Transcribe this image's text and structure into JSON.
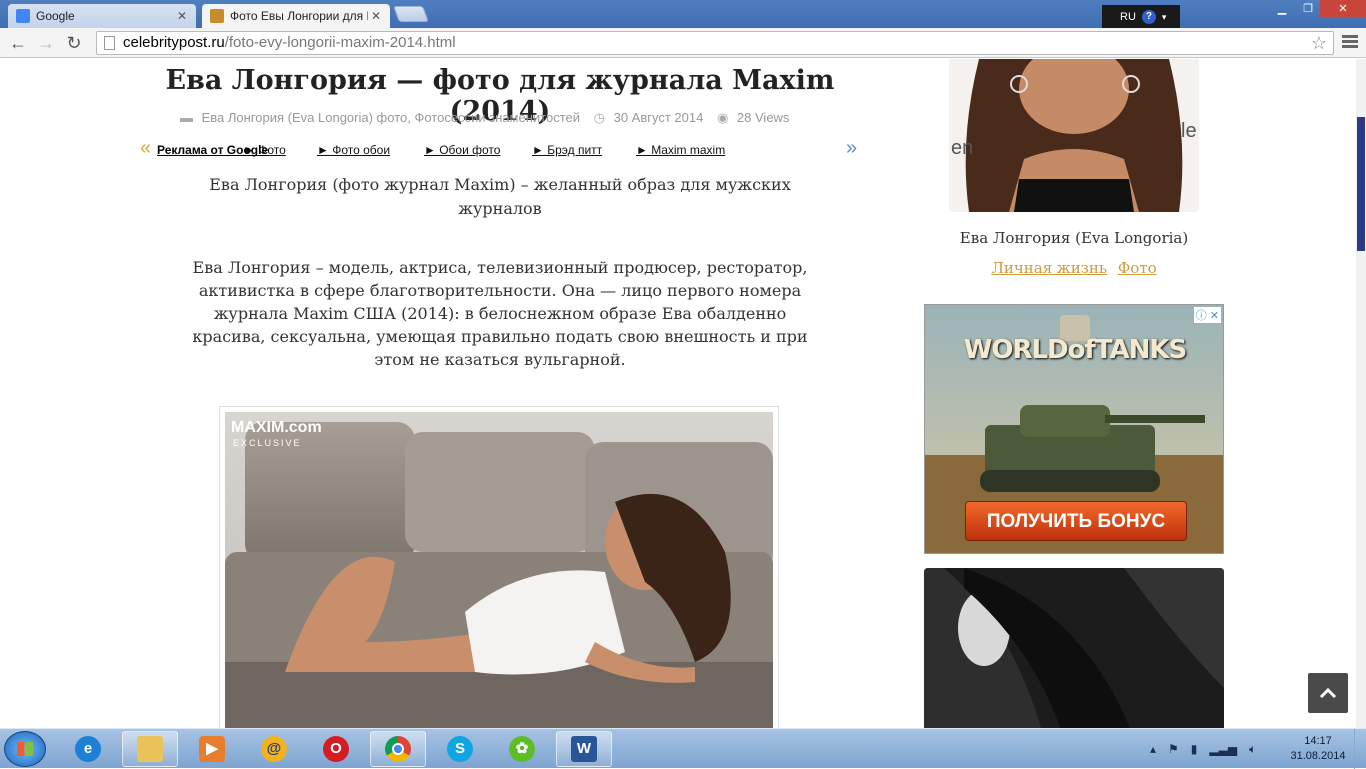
{
  "browser": {
    "tabs": [
      {
        "title": "Google",
        "active": false
      },
      {
        "title": "Фото Евы Лонгории для М",
        "active": true
      }
    ],
    "lang_widget": {
      "lang": "RU",
      "help": "?"
    },
    "url_host": "celebritypost.ru",
    "url_path": "/foto-evy-longorii-maxim-2014.html"
  },
  "article": {
    "title": "Ева Лонгория — фото для журнала Maxim (2014)",
    "meta_categories": "Ева Лонгория (Eva Longoria) фото, Фотосессии знаменитостей",
    "meta_date": "30 Август 2014",
    "meta_views": "28 Views",
    "subtitle": "Ева Лонгория (фото журнал Maxim) – желанный образ для мужских журналов",
    "intro": "Ева Лонгория – модель, актриса, телевизионный продюсер, ресторатор, активистка в сфере благотворительности. Она — лицо первого номера журнала Maxim США (2014): в белоснежном образе Ева обалденно красива, сексуальна, умеющая правильно подать свою внешность и при этом не казаться вульгарной.",
    "photo_watermark_1": "MAXIM.com",
    "photo_watermark_2": "EXCLUSIVE"
  },
  "adlinks": {
    "label": "Реклама от Google",
    "links": [
      "► Фото",
      "► Фото обои",
      "► Обои фото",
      "► Брэд питт",
      "► Maxim maxim"
    ]
  },
  "sidebar": {
    "profile_name": "Ева Лонгория (Eva Longoria)",
    "links": [
      "Личная жизнь",
      "Фото"
    ],
    "ad_logo": "WORLDofTANKS",
    "ad_button": "ПОЛУЧИТЬ БОНУС"
  },
  "taskbar": {
    "time": "14:17",
    "date": "31.08.2014"
  }
}
